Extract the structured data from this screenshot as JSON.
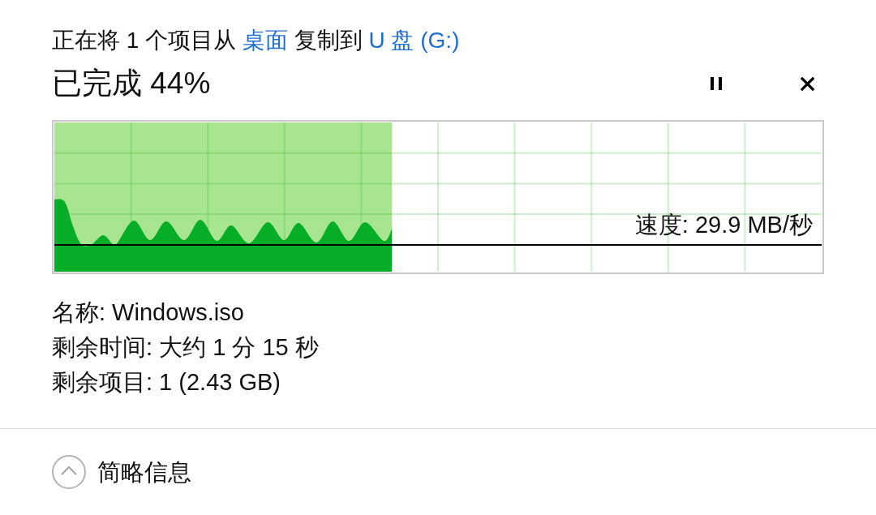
{
  "header": {
    "parts": [
      {
        "kind": "text",
        "text": "正在将 1 个项目从"
      },
      {
        "kind": "link",
        "text": "桌面"
      },
      {
        "kind": "text",
        "text": "复制到"
      },
      {
        "kind": "link",
        "text": "U 盘 (G:)"
      }
    ]
  },
  "progress": {
    "title": "已完成 44%",
    "level": 0.44,
    "speed": "速度: 29.9 MB/秒"
  },
  "details": [
    "名称: Windows.iso",
    "剩余时间: 大约 1 分 15 秒",
    "剩余项目: 1 (2.43 GB)"
  ],
  "footer": {
    "toggle_label": "简略信息"
  }
}
